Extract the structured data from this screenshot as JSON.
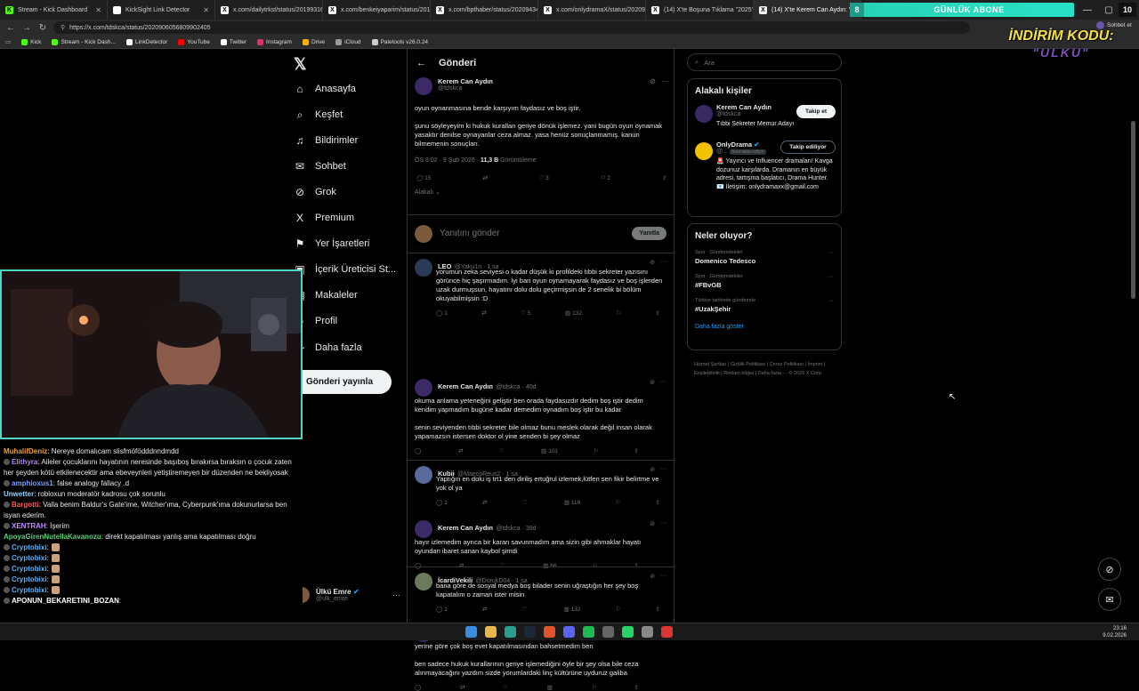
{
  "browser": {
    "tabs": [
      {
        "title": "Stream - Kick Dashboard",
        "color": "#53fc18",
        "glyph": "K"
      },
      {
        "title": "KickSight Link Detector",
        "color": "#ffffff",
        "glyph": ""
      },
      {
        "title": "x.com/dailytrkst/status/20199316",
        "color": "#ffffff",
        "glyph": "X"
      },
      {
        "title": "x.com/benkeiyaparim/status/2019",
        "color": "#ffffff",
        "glyph": "X"
      },
      {
        "title": "x.com/bpthaber/status/20209434",
        "color": "#ffffff",
        "glyph": "X"
      },
      {
        "title": "x.com/onlydramaX/status/202091",
        "color": "#ffffff",
        "glyph": "X"
      },
      {
        "title": "(14) X'te Boşuna Tıklama \"2025'te",
        "color": "#ffffff",
        "glyph": "X"
      },
      {
        "title": "(14) X'te Kerem Can Aydın: \"@onl",
        "color": "#ffffff",
        "glyph": "X"
      }
    ],
    "sub_banner": {
      "count": "8",
      "label": "GÜNLÜK ABONE"
    },
    "sub_count": "10",
    "url": "https://x.com/tdskca/status/2020906056809902405",
    "bookmarks": [
      {
        "label": "Kick",
        "color": "#53fc18"
      },
      {
        "label": "Stream - Kick Dash...",
        "color": "#53fc18"
      },
      {
        "label": "LinkDetector",
        "color": "#ffffff"
      },
      {
        "label": "YouTube",
        "color": "#ff0000"
      },
      {
        "label": "Twitter",
        "color": "#ffffff"
      },
      {
        "label": "Instagram",
        "color": "#e1306c"
      },
      {
        "label": "Drive",
        "color": "#f4b400"
      },
      {
        "label": "iCloud",
        "color": "#999999"
      },
      {
        "label": "Paletools v26.0.24",
        "color": "#cccccc"
      }
    ],
    "user_chip": "Sohbet et",
    "user_chip_sub": "Ayarlar"
  },
  "promo": {
    "line1": "İNDİRİM KODU:",
    "line2": "\"ULKU\""
  },
  "nav": {
    "items": [
      {
        "label": "Anasayfa",
        "icon": "home-icon",
        "glyph": "⌂"
      },
      {
        "label": "Keşfet",
        "icon": "search-icon",
        "glyph": "⌕"
      },
      {
        "label": "Bildirimler",
        "icon": "bell-icon",
        "glyph": "♫"
      },
      {
        "label": "Sohbet",
        "icon": "chat-icon",
        "glyph": "✉"
      },
      {
        "label": "Grok",
        "icon": "grok-icon",
        "glyph": "⊘"
      },
      {
        "label": "Premium",
        "icon": "x-premium-icon",
        "glyph": "X"
      },
      {
        "label": "Yer İşaretleri",
        "icon": "bookmark-icon",
        "glyph": "⚑"
      },
      {
        "label": "İçerik Üreticisi St...",
        "icon": "creator-studio-icon",
        "glyph": "▣"
      },
      {
        "label": "Makaleler",
        "icon": "articles-icon",
        "glyph": "▤"
      },
      {
        "label": "Profil",
        "icon": "profile-icon",
        "glyph": "☺"
      },
      {
        "label": "Daha fazla",
        "icon": "more-icon",
        "glyph": "⋯"
      }
    ],
    "post_button": "Gönderi yayınla",
    "me": {
      "name": "Ülkü Emre",
      "handle": "@ulk_emre"
    }
  },
  "main": {
    "header": "Gönderi",
    "post": {
      "name": "Kerem Can Aydın",
      "handle": "@tdskca",
      "text1": "oyun oynanmasına bende karşıyım faydasız ve boş iştir.",
      "text2": "şunu söyleyeyim ki hukuk kuralları geriye dönük işlemez. yani bugün oyun oynamak yasaktır denilse oynayanlar ceza almaz. yasa henüz sonuçlanmamış. kanun bilmemenin sonuçları.",
      "time": "ÖS 8:02 · 9 Şub 2026 · ",
      "views": "11,3 B",
      "views_label": " Görüntüleme",
      "replies": "15",
      "likes": "3",
      "bookmarks": "2",
      "sort": "Alakalı"
    },
    "composer": {
      "placeholder": "Yanıtını gönder",
      "button": "Yanıtla"
    },
    "replies": [
      {
        "name": "LEO",
        "handle": "@Yaku1n · 1 sa",
        "text": "yorumun zeka seviyesi o kadar düşük ki profildeki tıbbi sekreter yazısını görünce hiç şaşırmadım. İyi bari oyun oynamayarak faydasız ve boş işlerden uzak durmuşsun, hayatını dolu dolu geçirmişsin de 2 senelik bi bölüm okuyabilmişsin :D",
        "r": "1",
        "l": "5",
        "v": "132",
        "color": "#2a3a55"
      },
      {
        "name": "Kerem Can Aydın",
        "handle": "@tdskca · 40d",
        "text": "okuma anlama yeteneğini geliştir ben orada faydasızdır dedim boş iştir dedim kendim yapmadım bugüne kadar demedim oynadım boş iştir bu kadar",
        "text2": "senin seviyenden tıbbi sekreter bile olmaz bunu meslek olarak değil insan olarak yapamazsın istersen doktor ol yine senden bi şey olmaz",
        "r": "",
        "l": "",
        "v": "101",
        "color": "#3b2a66"
      },
      {
        "name": "Kubii",
        "handle": "@MaecoReus2 · 1 sa",
        "text": "Yaptığın en dolu iş trt1 den diriliş ertuğrul izlemek,lütfen sen fikir belirtme ve yok ol ya",
        "r": "1",
        "l": "",
        "v": "116",
        "color": "#5a6a9a"
      },
      {
        "name": "Kerem Can Aydın",
        "handle": "@tdskca · 39d",
        "text": "hayır izlemedim ayrıca bir karan savunmadım ama sizin gibi ahmaklar hayatı oyundan ibaret sanan kaybol şimdi",
        "r": "",
        "l": "",
        "v": "66",
        "color": "#3b2a66"
      },
      {
        "name": "İcardiVekili",
        "handle": "@DorukD04 · 1 sa",
        "text": "bana göre de sosyal medya boş bilader senin uğraştığın her şey boş kapatalım o zaman ister misin",
        "r": "1",
        "l": "",
        "v": "132",
        "color": "#6a7a5a"
      },
      {
        "name": "Kerem Can Aydın",
        "handle": "@tdskca · 36d",
        "text": "yerine göre çok boş evet kapatılmasından bahsetmedim ben",
        "text2": "ben sadece hukuk kurallarının geriye işlemediğini öyle bir şey olsa bile ceza alınmayacağını yazdım sizde yorumlardaki linç kültürüne uyduruz galiba",
        "r": "",
        "l": "",
        "v": "",
        "color": "#3b2a66"
      }
    ]
  },
  "right": {
    "search_placeholder": "Ara",
    "related_title": "Alakalı kişiler",
    "people": [
      {
        "name": "Kerem Can Aydın",
        "handle": "@tdskca",
        "bio": "Tıbbi Sekreter Memur Adayı",
        "button": "Takip et"
      },
      {
        "name": "OnlyDrama",
        "handle": "@...",
        "badge": "Seni takip ediyor",
        "bio": "🚨 Yayıncı ve Influencer dramaları! Kavga dozunuz karşılarda. Dramanın en büyük adresi, tartışma başlatıcı, Drama Hunter. 📧 İletişim: onlydramaxx@gmail.com",
        "button": "Takip ediliyor"
      }
    ],
    "trends_title": "Neler oluyor?",
    "trends": [
      {
        "cat": "Spor · Gündemdekiler",
        "name": "Domenico Tedesco"
      },
      {
        "cat": "Spor · Gündemdekiler",
        "name": "#FBvGB"
      },
      {
        "cat": "Türkiye tarihinde gündemde",
        "name": "#UzakŞehir"
      }
    ],
    "show_more": "Daha fazla göster",
    "footer": "Hizmet Şartları | Gizlilik Politikası | Çerez Politikası | İmprint | Erişilebilirlik | Reklam bilgisi | Daha fazla ··· © 2026 X Corp."
  },
  "chat": {
    "messages": [
      {
        "user": "MuhalifDeniz",
        "color": "#f0a030",
        "text": ": Nereye domalıcam slisfmöfödddnndmdd"
      },
      {
        "user": "Elithyra",
        "color": "#b084f5",
        "text": ": Aileler çocuklarını hayatının neresinde başıboş bırakırsa bıraksın o çocuk zaten her şeyden kötü etkilenecektir ama ebeveynleri yetiştiremeyen bir düzenden ne bekliyosak"
      },
      {
        "user": "amphioxus1",
        "color": "#7aa0ff",
        "text": ": false analogy fallacy .d"
      },
      {
        "user": "Unwetter",
        "color": "#8fd2ff",
        "text": ": robloxun moderatör kadrosu çok sorunlu"
      },
      {
        "user": "Bargotti",
        "color": "#ff5a5a",
        "text": ": Valla benim Baldur's Gate'ime, Witcher'ıma, Cyberpunk'ıma dokunurlarsa ben isyan ederim."
      },
      {
        "user": "XENTRAH",
        "color": "#c38cff",
        "text": ": İşerim"
      },
      {
        "user": "ApoyaGirenNutellaKavanozu",
        "color": "#5ad07a",
        "text": ": direkt kapatılması yanlış ama kapatılması doğru"
      },
      {
        "user": "Cryptobixi",
        "color": "#4fb3ff",
        "text": ":"
      },
      {
        "user": "Cryptobixi",
        "color": "#4fb3ff",
        "text": ":"
      },
      {
        "user": "Cryptobixi",
        "color": "#4fb3ff",
        "text": ":"
      },
      {
        "user": "Cryptobixi",
        "color": "#4fb3ff",
        "text": ":"
      },
      {
        "user": "Cryptobixi",
        "color": "#4fb3ff",
        "text": ":"
      },
      {
        "user": "APONUN_BEKARETINI_BOZAN",
        "color": "#ffffff",
        "text": ":"
      }
    ]
  },
  "taskbar": {
    "time": "23:16",
    "date": "9.02.2026"
  }
}
